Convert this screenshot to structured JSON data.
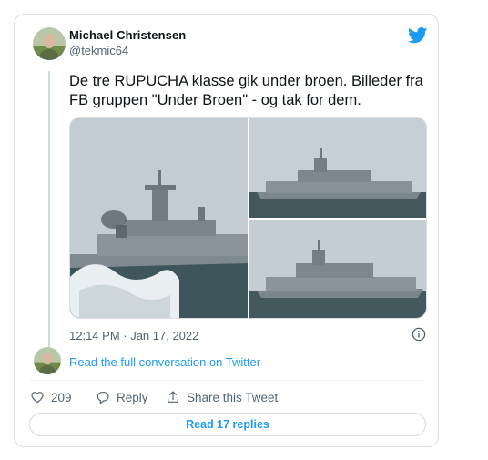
{
  "tweet": {
    "author": {
      "display_name": "Michael Christensen",
      "handle": "@tekmic64",
      "avatar_icon": "user-avatar"
    },
    "brand_icon": "twitter-bird-icon",
    "text": "De tre RUPUCHA klasse gik under broen. Billeder fra FB gruppen \"Under Broen\" - og tak for dem.",
    "media": {
      "count": 3,
      "items": [
        "ship-photo-waves",
        "ship-photo-right-top",
        "ship-photo-right-bottom"
      ]
    },
    "timestamp": "12:14 PM · Jan 17, 2022",
    "read_full": "Read the full conversation on Twitter",
    "actions": {
      "likes_count": "209",
      "reply_label": "Reply",
      "share_label": "Share this Tweet"
    },
    "replies_button": "Read 17 replies"
  },
  "colors": {
    "accent": "#1d9bf0",
    "text": "#0f1419",
    "muted": "#536471",
    "border": "#d8dde1"
  }
}
